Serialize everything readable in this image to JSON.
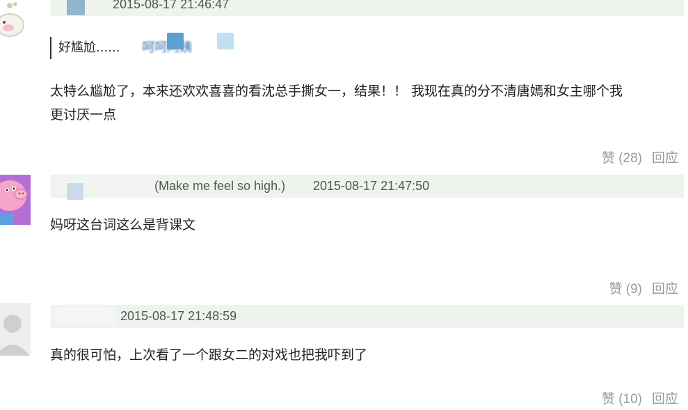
{
  "comments": [
    {
      "username": "",
      "time": "2015-08-17 21:46:47",
      "quote": "好尴尬......",
      "quote_trail": "呵呵阿姨",
      "text_line1": "太特么尴尬了，本来还欢欢喜喜的看沈总手撕女一，结果！！ 我现在真的分不清唐嫣和女主哪个我",
      "text_line2": "更讨厌一点",
      "like_label": "赞 (28)",
      "reply_label": "回应"
    },
    {
      "username": "(Make me feel so high.)",
      "time": "2015-08-17 21:47:50",
      "text_line1": "妈呀这台词这么是背课文",
      "like_label": "赞 (9)",
      "reply_label": "回应"
    },
    {
      "username": "",
      "time": "2015-08-17 21:48:59",
      "text_line1": "真的很可怕，上次看了一个跟女二的对戏也把我吓到了",
      "like_label": "赞 (10)",
      "reply_label": "回应"
    }
  ],
  "colors": {
    "bar": "#eef3ee",
    "meta_text": "#555555",
    "action_text": "#9a9a9a",
    "body_text": "#222222",
    "avatar_pink": "#f4a5c8",
    "avatar_purple": "#b46fd6"
  },
  "icons": [
    "avatar-cartoon",
    "avatar-peppa-pig",
    "avatar-default-gray"
  ]
}
